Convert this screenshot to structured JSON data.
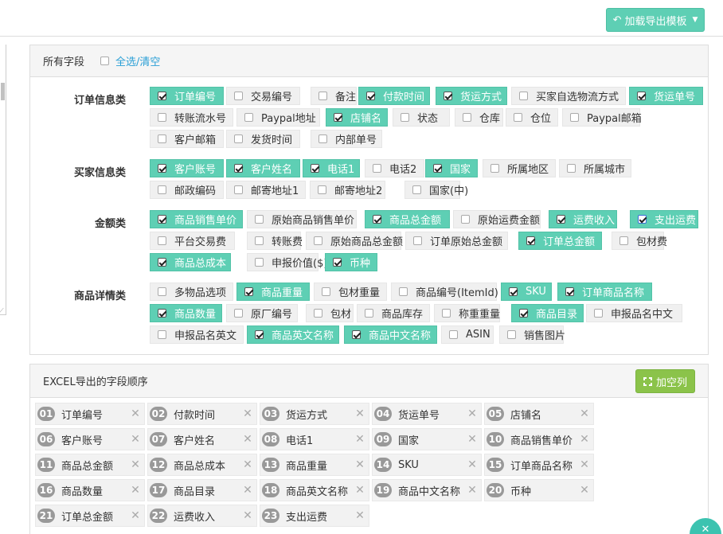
{
  "toolbar": {
    "load_template_label": "加载导出模板"
  },
  "fields_panel": {
    "title": "所有字段",
    "select_all_label": "全选/清空",
    "groups": [
      {
        "label": "订单信息类",
        "items": [
          {
            "label": "订单编号",
            "checked": true
          },
          {
            "label": "交易编号",
            "checked": false
          },
          {
            "label": "备注",
            "checked": false
          },
          {
            "label": "付款时间",
            "checked": true
          },
          {
            "label": "货运方式",
            "checked": true
          },
          {
            "label": "买家自选物流方式",
            "checked": false
          },
          {
            "label": "货运单号",
            "checked": true
          },
          {
            "label": "转账流水号",
            "checked": false
          },
          {
            "label": "Paypal地址",
            "checked": false
          },
          {
            "label": "店铺名",
            "checked": true
          },
          {
            "label": "状态",
            "checked": false
          },
          {
            "label": "仓库",
            "checked": false
          },
          {
            "label": "仓位",
            "checked": false
          },
          {
            "label": "Paypal邮箱",
            "checked": false
          },
          {
            "label": "客户邮箱",
            "checked": false
          },
          {
            "label": "发货时间",
            "checked": false
          },
          {
            "label": "内部单号",
            "checked": false
          }
        ]
      },
      {
        "label": "买家信息类",
        "items": [
          {
            "label": "客户账号",
            "checked": true
          },
          {
            "label": "客户姓名",
            "checked": true
          },
          {
            "label": "电话1",
            "checked": true
          },
          {
            "label": "电话2",
            "checked": false
          },
          {
            "label": "国家",
            "checked": true
          },
          {
            "label": "所属地区",
            "checked": false
          },
          {
            "label": "所属城市",
            "checked": false
          },
          {
            "label": "邮政编码",
            "checked": false
          },
          {
            "label": "邮寄地址1",
            "checked": false
          },
          {
            "label": "邮寄地址2",
            "checked": false
          },
          {
            "label": "国家(中)",
            "checked": false
          }
        ]
      },
      {
        "label": "金额类",
        "items": [
          {
            "label": "商品销售单价",
            "checked": true
          },
          {
            "label": "原始商品销售单价",
            "checked": false
          },
          {
            "label": "商品总金额",
            "checked": true
          },
          {
            "label": "原始运费金额",
            "checked": false
          },
          {
            "label": "运费收入",
            "checked": true
          },
          {
            "label": "支出运费",
            "checked": true
          },
          {
            "label": "平台交易费",
            "checked": false
          },
          {
            "label": "转账费",
            "checked": false
          },
          {
            "label": "原始商品总金额",
            "checked": false
          },
          {
            "label": "订单原始总金额",
            "checked": false
          },
          {
            "label": "订单总金额",
            "checked": true
          },
          {
            "label": "包材费",
            "checked": false
          },
          {
            "label": "商品总成本",
            "checked": true
          },
          {
            "label": "申报价值($)",
            "checked": false
          },
          {
            "label": "币种",
            "checked": true
          }
        ]
      },
      {
        "label": "商品详情类",
        "items": [
          {
            "label": "多物品选项",
            "checked": false
          },
          {
            "label": "商品重量",
            "checked": true
          },
          {
            "label": "包材重量",
            "checked": false
          },
          {
            "label": "商品编号(ItemId)",
            "checked": false
          },
          {
            "label": "SKU",
            "checked": true
          },
          {
            "label": "订单商品名称",
            "checked": true
          },
          {
            "label": "商品数量",
            "checked": true
          },
          {
            "label": "原厂编号",
            "checked": false
          },
          {
            "label": "包材",
            "checked": false
          },
          {
            "label": "商品库存",
            "checked": false
          },
          {
            "label": "称重重量",
            "checked": false
          },
          {
            "label": "商品目录",
            "checked": true
          },
          {
            "label": "申报品名中文",
            "checked": false
          },
          {
            "label": "申报品名英文",
            "checked": false
          },
          {
            "label": "商品英文名称",
            "checked": true
          },
          {
            "label": "商品中文名称",
            "checked": true
          },
          {
            "label": "ASIN",
            "checked": false
          },
          {
            "label": "销售图片",
            "checked": false
          }
        ]
      }
    ]
  },
  "order_panel": {
    "title": "EXCEL导出的字段顺序",
    "add_column_label": "加空列",
    "remove_symbol": "✕",
    "items": [
      {
        "num": "01",
        "label": "订单编号"
      },
      {
        "num": "02",
        "label": "付款时间"
      },
      {
        "num": "03",
        "label": "货运方式"
      },
      {
        "num": "04",
        "label": "货运单号"
      },
      {
        "num": "05",
        "label": "店铺名"
      },
      {
        "num": "06",
        "label": "客户账号"
      },
      {
        "num": "07",
        "label": "客户姓名"
      },
      {
        "num": "08",
        "label": "电话1"
      },
      {
        "num": "09",
        "label": "国家"
      },
      {
        "num": "10",
        "label": "商品销售单价"
      },
      {
        "num": "11",
        "label": "商品总金额"
      },
      {
        "num": "12",
        "label": "商品总成本"
      },
      {
        "num": "13",
        "label": "商品重量"
      },
      {
        "num": "14",
        "label": "SKU"
      },
      {
        "num": "15",
        "label": "订单商品名称"
      },
      {
        "num": "16",
        "label": "商品数量"
      },
      {
        "num": "17",
        "label": "商品目录"
      },
      {
        "num": "18",
        "label": "商品英文名称"
      },
      {
        "num": "19",
        "label": "商品中文名称"
      },
      {
        "num": "20",
        "label": "币种"
      },
      {
        "num": "21",
        "label": "订单总金额"
      },
      {
        "num": "22",
        "label": "运费收入"
      },
      {
        "num": "23",
        "label": "支出运费"
      }
    ]
  },
  "fab": {
    "icon": "close-icon"
  },
  "colors": {
    "accent": "#5ecfb4",
    "add_button": "#8bc34a",
    "link": "#2a9fd6"
  }
}
